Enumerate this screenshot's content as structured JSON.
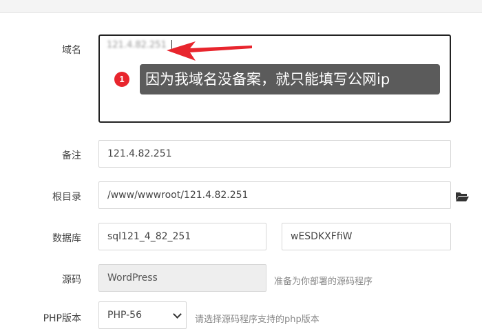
{
  "form": {
    "domain": {
      "label": "域名",
      "value": "121.4.82.251"
    },
    "annotation": {
      "badge": "1",
      "tooltip": "因为我域名没备案，就只能填写公网ip"
    },
    "remark": {
      "label": "备注",
      "value": "121.4.82.251"
    },
    "root_dir": {
      "label": "根目录",
      "value": "/www/wwwroot/121.4.82.251",
      "icon": "folder-open-icon"
    },
    "database": {
      "label": "数据库",
      "name_value": "sql121_4_82_251",
      "password_value": "wESDKXFfiW"
    },
    "source": {
      "label": "源码",
      "value": "WordPress",
      "hint": "准备为你部署的源码程序"
    },
    "php": {
      "label": "PHP版本",
      "selected": "PHP-56",
      "hint": "请选择源码程序支持的php版本"
    }
  },
  "colors": {
    "annotation_arrow": "#e8252d",
    "tooltip_bg": "#5b5b5b",
    "badge": "#e8252d"
  }
}
